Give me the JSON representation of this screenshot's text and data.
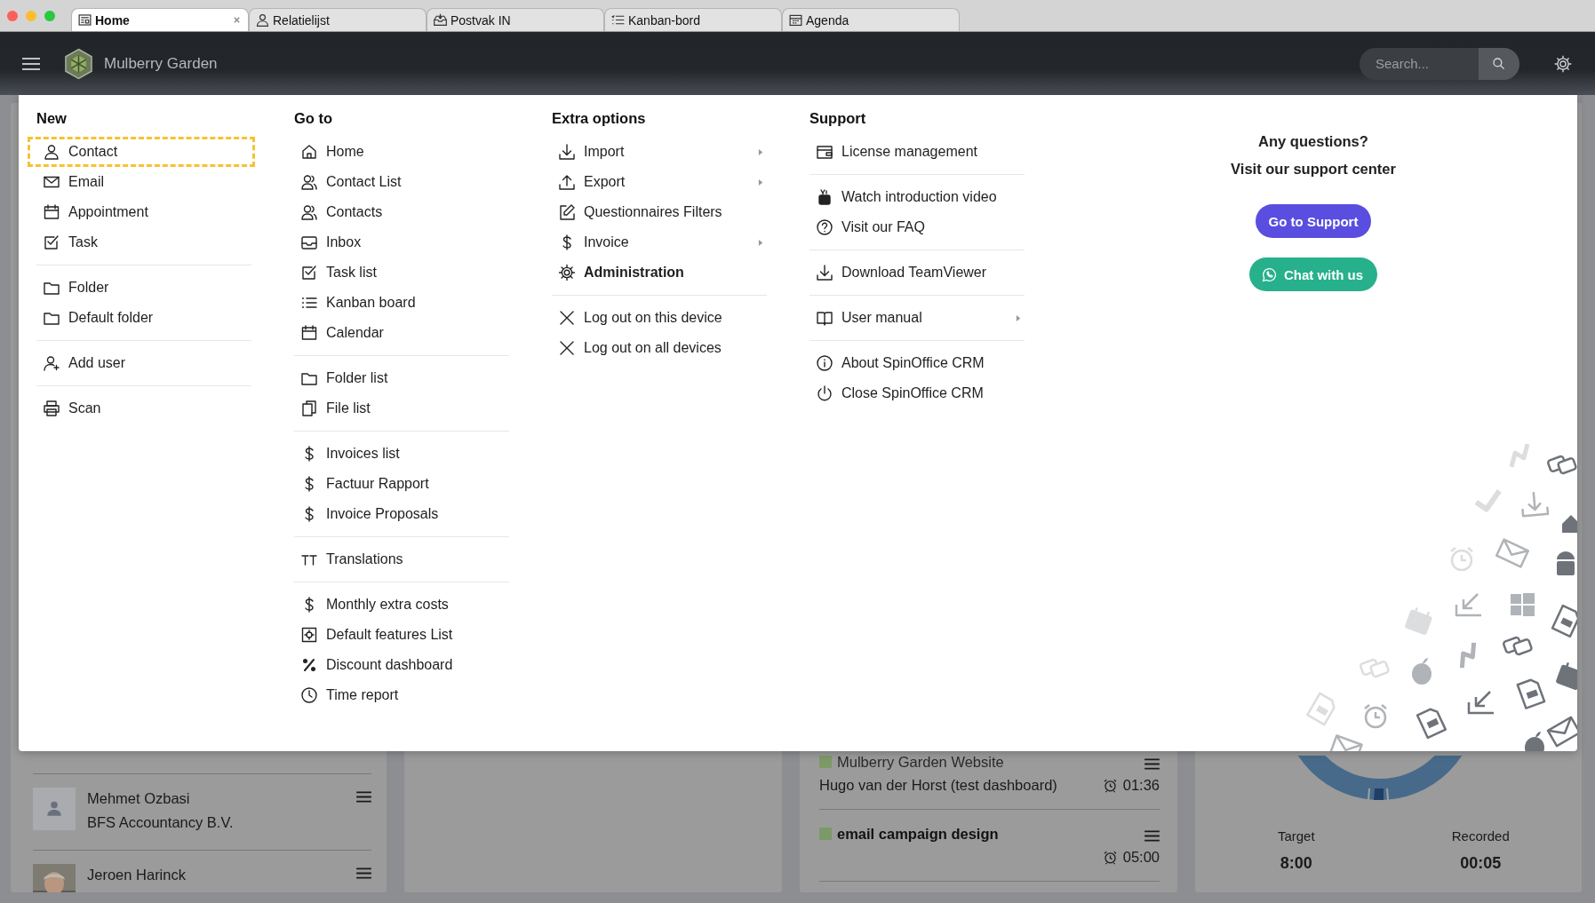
{
  "browser_tabs": [
    {
      "label": "Home",
      "selected": true
    },
    {
      "label": "Relatielijst",
      "selected": false
    },
    {
      "label": "Postvak IN",
      "selected": false
    },
    {
      "label": "Kanban-bord",
      "selected": false
    },
    {
      "label": "Agenda",
      "selected": false
    }
  ],
  "header": {
    "app_name": "Mulberry Garden",
    "search": {
      "placeholder": "Search..."
    }
  },
  "menu": {
    "columns": [
      {
        "heading": "New",
        "groups": [
          [
            {
              "label": "Contact",
              "highlighted": true,
              "bold": false,
              "submenu": false
            },
            {
              "label": "Email",
              "highlighted": false,
              "bold": false,
              "submenu": false
            },
            {
              "label": "Appointment",
              "highlighted": false,
              "bold": false,
              "submenu": false
            },
            {
              "label": "Task",
              "highlighted": false,
              "bold": false,
              "submenu": false
            }
          ],
          [
            {
              "label": "Folder",
              "highlighted": false,
              "bold": false,
              "submenu": false
            },
            {
              "label": "Default folder",
              "highlighted": false,
              "bold": false,
              "submenu": false
            }
          ],
          [
            {
              "label": "Add user",
              "highlighted": false,
              "bold": false,
              "submenu": false
            }
          ],
          [
            {
              "label": "Scan",
              "highlighted": false,
              "bold": false,
              "submenu": false
            }
          ]
        ]
      },
      {
        "heading": "Go to",
        "groups": [
          [
            {
              "label": "Home",
              "highlighted": false,
              "bold": false,
              "submenu": false
            },
            {
              "label": "Contact List",
              "highlighted": false,
              "bold": false,
              "submenu": false
            },
            {
              "label": "Contacts",
              "highlighted": false,
              "bold": false,
              "submenu": false
            },
            {
              "label": "Inbox",
              "highlighted": false,
              "bold": false,
              "submenu": false
            },
            {
              "label": "Task list",
              "highlighted": false,
              "bold": false,
              "submenu": false
            },
            {
              "label": "Kanban board",
              "highlighted": false,
              "bold": false,
              "submenu": false
            },
            {
              "label": "Calendar",
              "highlighted": false,
              "bold": false,
              "submenu": false
            }
          ],
          [
            {
              "label": "Folder list",
              "highlighted": false,
              "bold": false,
              "submenu": false
            },
            {
              "label": "File list",
              "highlighted": false,
              "bold": false,
              "submenu": false
            }
          ],
          [
            {
              "label": "Invoices list",
              "highlighted": false,
              "bold": false,
              "submenu": false
            },
            {
              "label": "Factuur Rapport",
              "highlighted": false,
              "bold": false,
              "submenu": false
            },
            {
              "label": "Invoice Proposals",
              "highlighted": false,
              "bold": false,
              "submenu": false
            }
          ],
          [
            {
              "label": "Translations",
              "highlighted": false,
              "bold": false,
              "submenu": false
            }
          ],
          [
            {
              "label": "Monthly extra costs",
              "highlighted": false,
              "bold": false,
              "submenu": false
            },
            {
              "label": "Default features List",
              "highlighted": false,
              "bold": false,
              "submenu": false
            },
            {
              "label": "Discount dashboard",
              "highlighted": false,
              "bold": false,
              "submenu": false
            },
            {
              "label": "Time report",
              "highlighted": false,
              "bold": false,
              "submenu": false
            }
          ]
        ]
      },
      {
        "heading": "Extra options",
        "groups": [
          [
            {
              "label": "Import",
              "highlighted": false,
              "bold": false,
              "submenu": true
            },
            {
              "label": "Export",
              "highlighted": false,
              "bold": false,
              "submenu": true
            },
            {
              "label": "Questionnaires Filters",
              "highlighted": false,
              "bold": false,
              "submenu": false
            },
            {
              "label": "Invoice",
              "highlighted": false,
              "bold": false,
              "submenu": true
            },
            {
              "label": "Administration",
              "highlighted": false,
              "bold": true,
              "submenu": false
            }
          ],
          [
            {
              "label": "Log out on this device",
              "highlighted": false,
              "bold": false,
              "submenu": false
            },
            {
              "label": "Log out on all devices",
              "highlighted": false,
              "bold": false,
              "submenu": false
            }
          ]
        ]
      },
      {
        "heading": "Support",
        "groups": [
          [
            {
              "label": "License management",
              "highlighted": false,
              "bold": false,
              "submenu": false
            }
          ],
          [
            {
              "label": "Watch introduction video",
              "highlighted": false,
              "bold": false,
              "submenu": false
            },
            {
              "label": "Visit our FAQ",
              "highlighted": false,
              "bold": false,
              "submenu": false
            }
          ],
          [
            {
              "label": "Download TeamViewer",
              "highlighted": false,
              "bold": false,
              "submenu": false
            }
          ],
          [
            {
              "label": "User manual",
              "highlighted": false,
              "bold": false,
              "submenu": true
            }
          ],
          [
            {
              "label": "About SpinOffice CRM",
              "highlighted": false,
              "bold": false,
              "submenu": false
            },
            {
              "label": "Close SpinOffice CRM",
              "highlighted": false,
              "bold": false,
              "submenu": false
            }
          ]
        ]
      }
    ],
    "support_panel": {
      "question": "Any questions?",
      "prompt": "Visit our support center",
      "buttons": [
        {
          "label": "Go to Support",
          "kind": "support"
        },
        {
          "label": "Chat with us",
          "kind": "chat"
        }
      ]
    }
  },
  "dashboard": {
    "contacts": [
      {
        "name": "Mehmet Ozbasi",
        "company": "BFS Accountancy B.V.",
        "kind": "placeholder"
      },
      {
        "name": "Jeroen Harinck",
        "kind": "picture"
      }
    ],
    "tasks": [
      {
        "heading": "Mulberry Garden Website",
        "color": "#7c9a68",
        "subtitle": "Hugo van der Horst (test dashboard)",
        "time": "01:36"
      },
      {
        "heading": "email campaign design",
        "color": "#7c9a68",
        "time": "05:00"
      }
    ],
    "hours": {
      "target_label": "Target",
      "target": "8:00",
      "recorded_label": "Recorded",
      "recorded": "00:05"
    }
  }
}
